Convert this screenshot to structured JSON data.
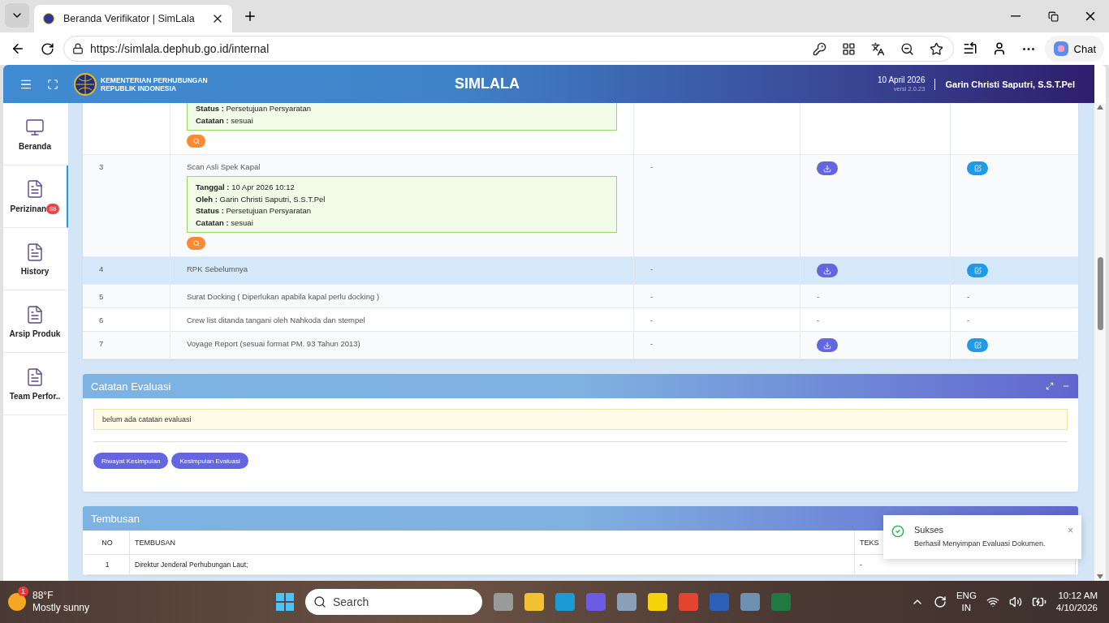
{
  "browser": {
    "tab_title": "Beranda Verifikator | SimLala",
    "url": "https://simlala.dephub.go.id/internal",
    "chat_label": "Chat"
  },
  "header": {
    "org_line1": "KEMENTERIAN PERHUBUNGAN",
    "org_line2": "REPUBLIK INDONESIA",
    "app_title": "SIMLALA",
    "date": "10 April 2026",
    "version": "versi 2.0.23",
    "user": "Garin Christi Saputri, S.S.T.Pel"
  },
  "sidebar": {
    "items": [
      {
        "label": "Beranda",
        "kind": "monitor",
        "selected": false
      },
      {
        "label": "Perizinan",
        "kind": "document",
        "selected": true,
        "badge": "88"
      },
      {
        "label": "History",
        "kind": "document",
        "selected": false
      },
      {
        "label": "Arsip Produk",
        "kind": "document",
        "selected": false
      },
      {
        "label": "Team Perfor..",
        "kind": "document",
        "selected": false
      }
    ]
  },
  "documents": {
    "rows": [
      {
        "no": "",
        "name": "",
        "hovered": false,
        "note": [
          {
            "label": "Status :",
            "value": "Persetujuan Persyaratan"
          },
          {
            "label": "Catatan :",
            "value": "sesuai"
          }
        ],
        "cells": [
          {
            "kind": "empty"
          },
          {
            "kind": "empty"
          },
          {
            "kind": "empty"
          }
        ]
      },
      {
        "no": "3",
        "name": "Scan Asli Spek Kapal",
        "hovered": false,
        "note": [
          {
            "label": "Tanggal :",
            "value": "10 Apr 2026 10:12"
          },
          {
            "label": "Oleh :",
            "value": "Garin Christi Saputri, S.S.T.Pel"
          },
          {
            "label": "Status :",
            "value": "Persetujuan Persyaratan"
          },
          {
            "label": "Catatan :",
            "value": "sesuai"
          }
        ],
        "cells": [
          {
            "kind": "text",
            "text": "-"
          },
          {
            "kind": "download"
          },
          {
            "kind": "edit"
          }
        ]
      },
      {
        "no": "4",
        "name": "RPK Sebelumnya",
        "hovered": true,
        "cells": [
          {
            "kind": "text",
            "text": "-"
          },
          {
            "kind": "download"
          },
          {
            "kind": "edit"
          }
        ]
      },
      {
        "no": "5",
        "name": "Surat Docking ( Diperlukan apabila kapal perlu docking )",
        "hovered": false,
        "cells": [
          {
            "kind": "text",
            "text": "-"
          },
          {
            "kind": "text",
            "text": "-"
          },
          {
            "kind": "text",
            "text": "-"
          }
        ]
      },
      {
        "no": "6",
        "name": "Crew list ditanda tangani oleh Nahkoda dan stempel",
        "hovered": false,
        "cells": [
          {
            "kind": "text",
            "text": "-"
          },
          {
            "kind": "text",
            "text": "-"
          },
          {
            "kind": "text",
            "text": "-"
          }
        ]
      },
      {
        "no": "7",
        "name": "Voyage Report (sesuai format PM. 93 Tahun 2013)",
        "hovered": false,
        "cells": [
          {
            "kind": "text",
            "text": "-"
          },
          {
            "kind": "download"
          },
          {
            "kind": "edit"
          }
        ]
      }
    ]
  },
  "evaluation": {
    "title": "Catatan Evaluasi",
    "note": "belum ada catatan evaluasi",
    "buttons": [
      "Riwayat Kesimpulan",
      "Kesimpulan Evaluasi"
    ]
  },
  "tembusan": {
    "title": "Tembusan",
    "columns": [
      "NO",
      "TEMBUSAN",
      "TEKS"
    ],
    "rows": [
      [
        "1",
        "Direktur Jenderal Perhubungan Laut;",
        "-"
      ]
    ]
  },
  "toast": {
    "title": "Sukses",
    "message": "Berhasil Menyimpan Evaluasi Dokumen.",
    "close": "×"
  },
  "taskbar": {
    "weather_badge": "1",
    "temperature": "88°F",
    "condition": "Mostly sunny",
    "search_placeholder": "Search",
    "lang1": "ENG",
    "lang2": "IN",
    "time": "10:12 AM",
    "date": "4/10/2026"
  }
}
